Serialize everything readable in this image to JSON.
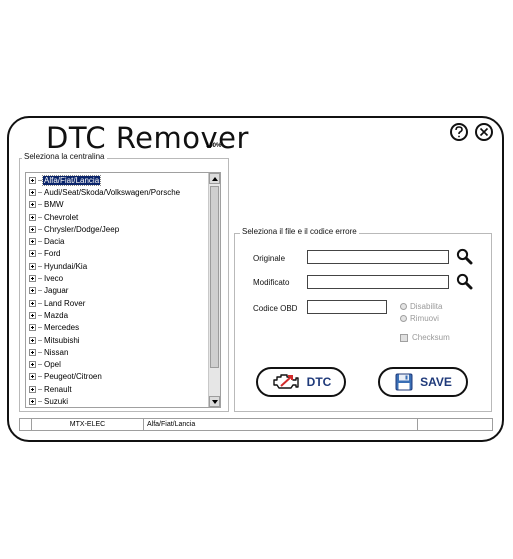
{
  "app": {
    "title": "DTC Remover",
    "progress": "100%"
  },
  "header_buttons": {
    "help_icon": "help-icon",
    "close_icon": "close-icon"
  },
  "ecu_panel": {
    "legend": "Seleziona la centralina",
    "items": [
      {
        "label": "Alfa/Fiat/Lancia",
        "selected": true
      },
      {
        "label": "Audi/Seat/Skoda/Volkswagen/Porsche"
      },
      {
        "label": "BMW"
      },
      {
        "label": "Chevrolet"
      },
      {
        "label": "Chrysler/Dodge/Jeep"
      },
      {
        "label": "Dacia"
      },
      {
        "label": "Ford"
      },
      {
        "label": "Hyundai/Kia"
      },
      {
        "label": "Iveco"
      },
      {
        "label": "Jaguar"
      },
      {
        "label": "Land Rover"
      },
      {
        "label": "Mazda"
      },
      {
        "label": "Mercedes"
      },
      {
        "label": "Mitsubishi"
      },
      {
        "label": "Nissan"
      },
      {
        "label": "Opel"
      },
      {
        "label": "Peugeot/Citroen"
      },
      {
        "label": "Renault"
      },
      {
        "label": "Suzuki"
      }
    ]
  },
  "file_panel": {
    "legend": "Seleziona il file e il codice errore",
    "original_label": "Originale",
    "original_value": "",
    "modified_label": "Modificato",
    "modified_value": "",
    "obd_label": "Codice OBD",
    "obd_value": "",
    "radio_disable": "Disabilita",
    "radio_remove": "Rimuovi",
    "checksum": "Checksum",
    "dtc_button": "DTC",
    "save_button": "SAVE"
  },
  "status_bar": {
    "ecu": "MTX-ELEC",
    "brand": "Alfa/Fiat/Lancia"
  },
  "colors": {
    "selection": "#0a246a",
    "button_text": "#1f3a7a",
    "engine_icon_accent": "#d12b2b",
    "save_icon": "#3a6fb5"
  }
}
